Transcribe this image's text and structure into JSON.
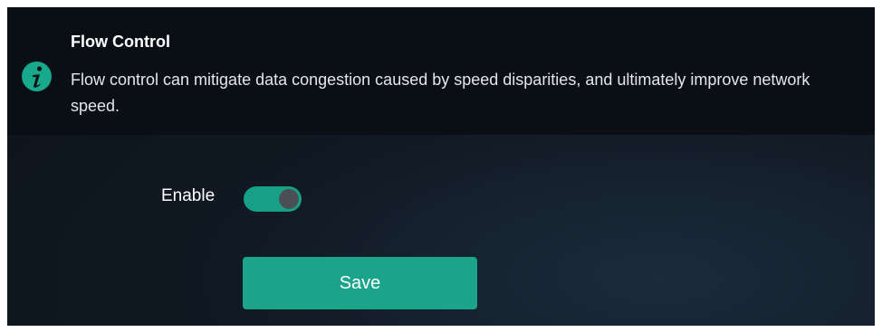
{
  "info": {
    "icon": "info-icon",
    "icon_color": "#18a88b",
    "title": "Flow Control",
    "description": "Flow control can mitigate data congestion caused by speed disparities, and ultimately improve network speed."
  },
  "form": {
    "enable_label": "Enable",
    "enable_state": "on",
    "toggle_color": "#16a085",
    "save_label": "Save",
    "save_color": "#1aa58a"
  },
  "colors": {
    "background": "#0f1720",
    "banner": "#0a0f15"
  }
}
